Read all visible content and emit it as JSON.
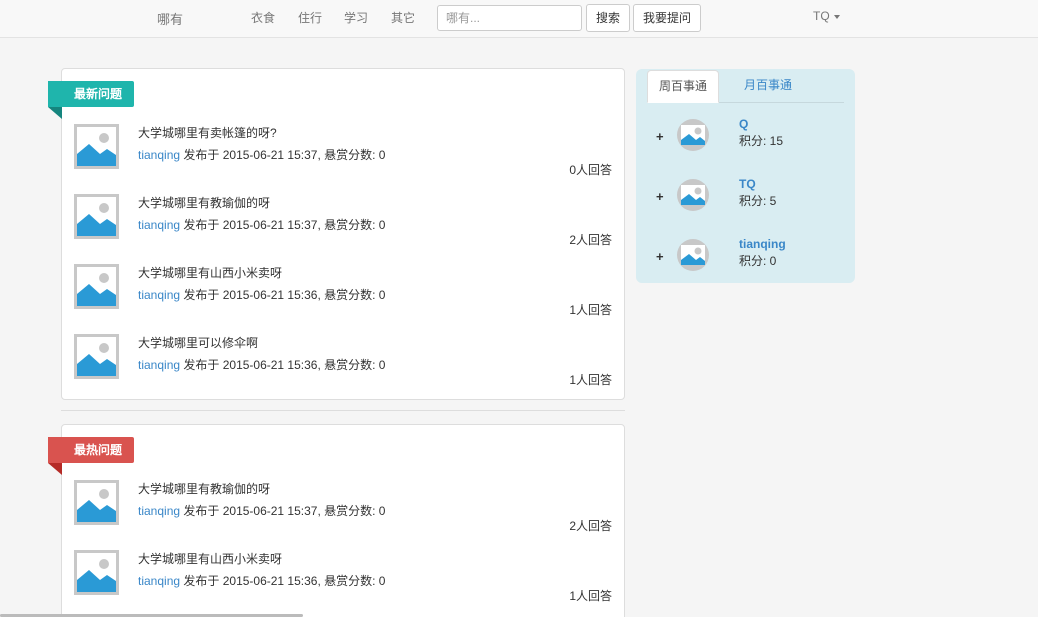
{
  "nav": {
    "brand": "哪有",
    "links": [
      "衣食",
      "住行",
      "学习",
      "其它"
    ],
    "search_placeholder": "哪有...",
    "search_button": "搜索",
    "ask_button": "我要提问",
    "user": "TQ"
  },
  "latest": {
    "label": "最新问题",
    "items": [
      {
        "title": "大学城哪里有卖帐篷的呀?",
        "author": "tianqing",
        "meta": " 发布于 2015-06-21 15:37, 悬赏分数: 0",
        "answers": "0人回答"
      },
      {
        "title": "大学城哪里有教瑜伽的呀",
        "author": "tianqing",
        "meta": " 发布于 2015-06-21 15:37, 悬赏分数: 0",
        "answers": "2人回答"
      },
      {
        "title": "大学城哪里有山西小米卖呀",
        "author": "tianqing",
        "meta": " 发布于 2015-06-21 15:36, 悬赏分数: 0",
        "answers": "1人回答"
      },
      {
        "title": "大学城哪里可以修伞啊",
        "author": "tianqing",
        "meta": " 发布于 2015-06-21 15:36, 悬赏分数: 0",
        "answers": "1人回答"
      }
    ]
  },
  "hot": {
    "label": "最热问题",
    "items": [
      {
        "title": "大学城哪里有教瑜伽的呀",
        "author": "tianqing",
        "meta": " 发布于 2015-06-21 15:37, 悬赏分数: 0",
        "answers": "2人回答"
      },
      {
        "title": "大学城哪里有山西小米卖呀",
        "author": "tianqing",
        "meta": " 发布于 2015-06-21 15:36, 悬赏分数: 0",
        "answers": "1人回答"
      }
    ]
  },
  "leaderboard": {
    "tabs": [
      "周百事通",
      "月百事通"
    ],
    "users": [
      {
        "plus": "+",
        "name": "Q",
        "score": "积分: 15"
      },
      {
        "plus": "+",
        "name": "TQ",
        "score": "积分: 5"
      },
      {
        "plus": "+",
        "name": "tianqing",
        "score": "积分: 0"
      }
    ]
  },
  "colors": {
    "link": "#3a87c8",
    "ribbon_new": "#1fb5ac",
    "ribbon_hot": "#d9534f",
    "board_bg": "#d9edf2"
  },
  "icons": {
    "thumbnail": "image-placeholder-icon",
    "avatar": "avatar-placeholder-icon",
    "caret": "caret-down-icon"
  }
}
